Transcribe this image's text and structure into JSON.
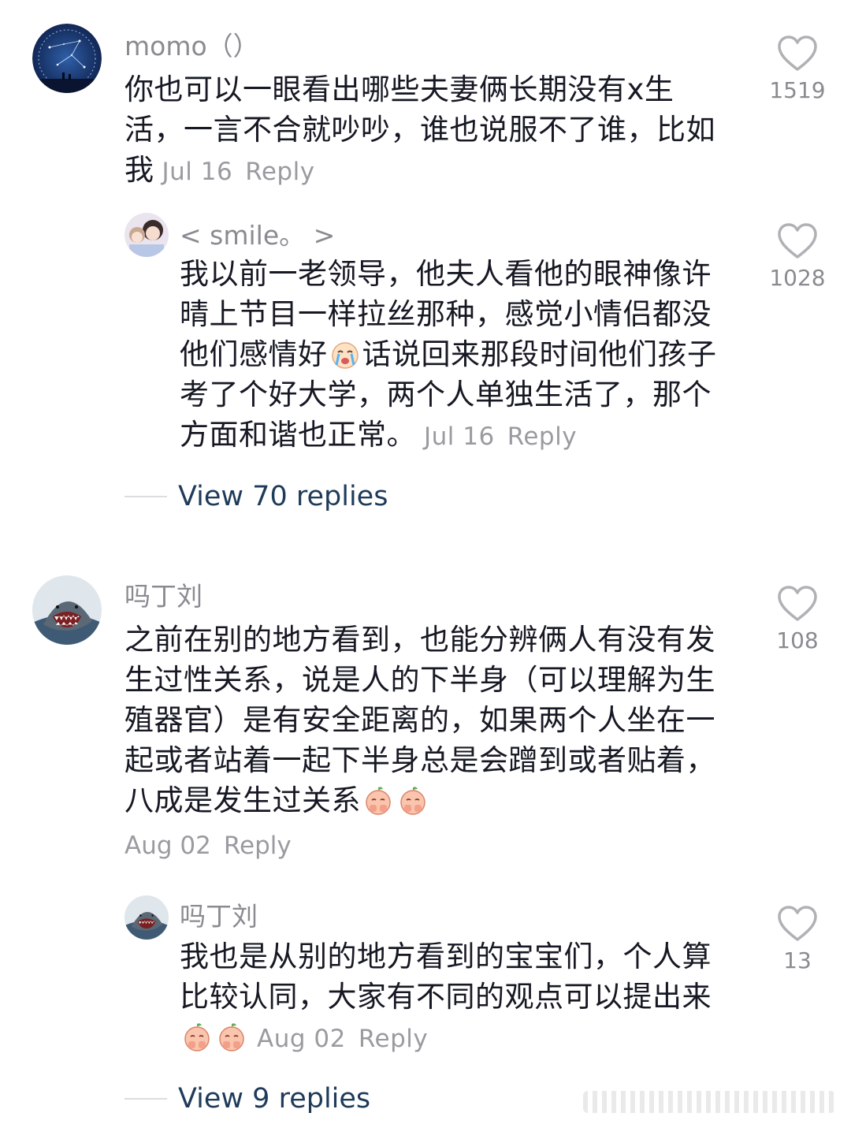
{
  "comments": [
    {
      "username": "momo（）",
      "text": "你也可以一眼看出哪些夫妻俩长期没有x生活，一言不合就吵吵，谁也说服不了谁，比如我",
      "date": "Jul 16",
      "reply_label": "Reply",
      "likes": "1519",
      "avatar": "starry-sky-avatar",
      "replies": [
        {
          "username": "< smile。 >",
          "text": "我以前一老领导，他夫人看他的眼神像许晴上节目一样拉丝那种，感觉小情侣都没他们感情好",
          "text_after_emoji": "话说回来那段时间他们孩子考了个好大学，两个人单独生活了，那个方面和谐也正常。",
          "emoji": "crying-emoji",
          "date": "Jul 16",
          "reply_label": "Reply",
          "likes": "1028",
          "avatar": "anime-girls-avatar"
        }
      ],
      "view_replies": "View 70 replies"
    },
    {
      "username": "吗丁刘",
      "text": "之前在别的地方看到，也能分辨俩人有没有发生过性关系，说是人的下半身（可以理解为生殖器官）是有安全距离的，如果两个人坐在一起或者站着一起下半身总是会蹭到或者贴着，八成是发生过关系",
      "emoji": "peach-shy-emoji",
      "date": "Aug 02",
      "reply_label": "Reply",
      "likes": "108",
      "avatar": "shark-avatar",
      "replies": [
        {
          "username": "吗丁刘",
          "text": "我也是从别的地方看到的宝宝们，个人算比较认同，大家有不同的观点可以提出来",
          "emoji": "peach-shy-emoji",
          "date": "Aug 02",
          "reply_label": "Reply",
          "likes": "13",
          "avatar": "shark-avatar"
        }
      ],
      "view_replies": "View 9 replies"
    }
  ],
  "colors": {
    "text": "#161823",
    "username": "#8a8b91",
    "meta": "#9a9ba0",
    "view_replies": "#1f3b5a",
    "heart_stroke": "#b0b1b5"
  }
}
